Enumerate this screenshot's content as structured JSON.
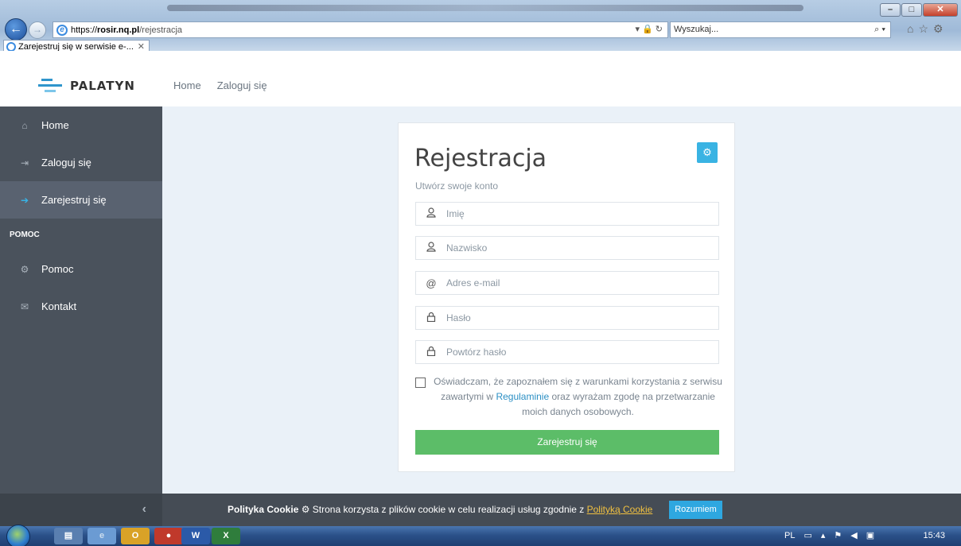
{
  "browser": {
    "url_protocol": "https://",
    "url_host": "rosir.nq.pl",
    "url_path": "/rejestracja",
    "address_icons": "▾ 🔒 ↻",
    "search_placeholder": "Wyszukaj...",
    "tab_title": "Zarejestruj się w serwisie e-...",
    "tab_close": "✕"
  },
  "header": {
    "brand": "PALATYN",
    "nav": [
      "Home",
      "Zaloguj się"
    ]
  },
  "sidebar": {
    "items": [
      {
        "label": "Home",
        "icon": "home-icon",
        "glyph": "⌂"
      },
      {
        "label": "Zaloguj się",
        "icon": "login-icon",
        "glyph": "⇥"
      },
      {
        "label": "Zarejestruj się",
        "icon": "register-icon",
        "glyph": "➔"
      }
    ],
    "section_title": "POMOC",
    "help_items": [
      {
        "label": "Pomoc",
        "icon": "help-icon",
        "glyph": "⚙"
      },
      {
        "label": "Kontakt",
        "icon": "mail-icon",
        "glyph": "✉"
      }
    ],
    "collapse_glyph": "‹"
  },
  "form": {
    "title": "Rejestracja",
    "subtitle": "Utwórz swoje konto",
    "settings_glyph": "⚙",
    "fields": [
      {
        "placeholder": "Imię",
        "glyph": "👤",
        "icon": "user-icon"
      },
      {
        "placeholder": "Nazwisko",
        "glyph": "👤",
        "icon": "user-icon"
      },
      {
        "placeholder": "Adres e-mail",
        "glyph": "@",
        "icon": "at-icon"
      },
      {
        "placeholder": "Hasło",
        "glyph": "🔒",
        "icon": "lock-icon"
      },
      {
        "placeholder": "Powtórz hasło",
        "glyph": "🔒",
        "icon": "lock-icon"
      }
    ],
    "agree_before": "Oświadczam, że zapoznałem się z warunkami korzystania z serwisu zawartymi w ",
    "agree_link": "Regulaminie",
    "agree_after": " oraz wyrażam zgodę na przetwarzanie moich danych osobowych.",
    "submit": "Zarejestruj się"
  },
  "cookie": {
    "title": "Polityka Cookie",
    "text": " ⚙ Strona korzysta z plików cookie w celu realizacji usług zgodnie z ",
    "link": "Polityką Cookie",
    "button": "Rozumiem"
  },
  "taskbar": {
    "lang": "PL",
    "time": "15:43"
  },
  "colors": {
    "sidebar": "#4a525c",
    "accent": "#39b3e3",
    "submit": "#5cbd68"
  }
}
